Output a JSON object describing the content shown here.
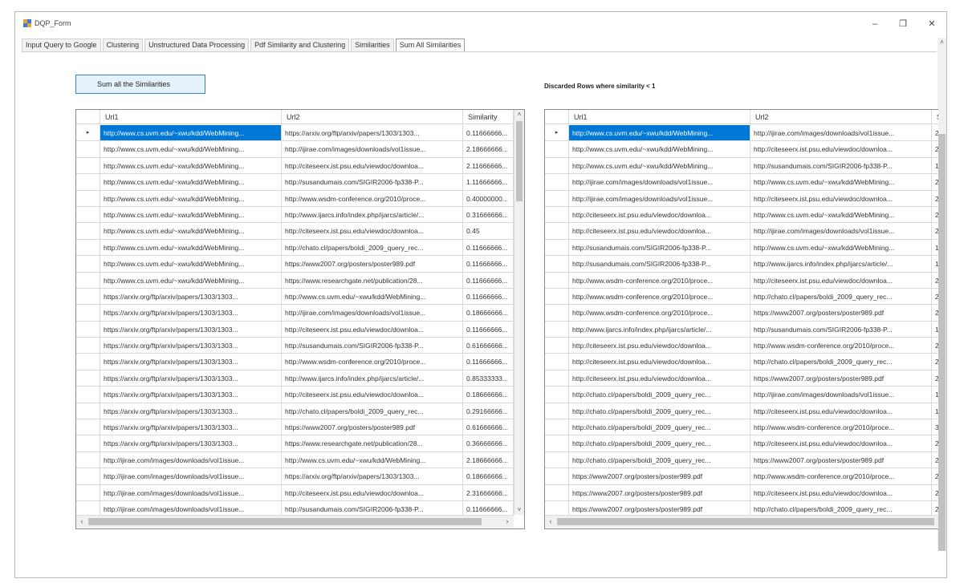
{
  "window": {
    "title": "DQP_Form",
    "controls": {
      "minimize": "–",
      "maximize": "❐",
      "close": "✕"
    }
  },
  "tabs": [
    {
      "label": "Input Query to Google",
      "active": false
    },
    {
      "label": "Clustering",
      "active": false
    },
    {
      "label": "Unstructured Data Processing",
      "active": false
    },
    {
      "label": "Pdf Similarity and Clustering",
      "active": false
    },
    {
      "label": "Similarities",
      "active": false
    },
    {
      "label": "Sum All Similarities",
      "active": true
    }
  ],
  "sum_button": {
    "label": "Sum all the Similarities"
  },
  "discarded_label": "Discarded Rows where similarity < 1",
  "left_grid": {
    "columns": [
      "Url1",
      "Url2",
      "Similarity"
    ],
    "rows": [
      [
        "http://www.cs.uvm.edu/~xwu/kdd/WebMining...",
        "https://arxiv.org/ftp/arxiv/papers/1303/1303...",
        "0.11666666..."
      ],
      [
        "http://www.cs.uvm.edu/~xwu/kdd/WebMining...",
        "http://ijirae.com/images/downloads/vol1issue...",
        "2.18666666..."
      ],
      [
        "http://www.cs.uvm.edu/~xwu/kdd/WebMining...",
        "http://citeseerx.ist.psu.edu/viewdoc/downloa...",
        "2.11666666..."
      ],
      [
        "http://www.cs.uvm.edu/~xwu/kdd/WebMining...",
        "http://susandumais.com/SIGIR2006-fp338-P...",
        "1.11666666..."
      ],
      [
        "http://www.cs.uvm.edu/~xwu/kdd/WebMining...",
        "http://www.wsdm-conference.org/2010/proce...",
        "0.40000000..."
      ],
      [
        "http://www.cs.uvm.edu/~xwu/kdd/WebMining...",
        "http://www.ijarcs.info/index.php/ijarcs/article/...",
        "0.31666666..."
      ],
      [
        "http://www.cs.uvm.edu/~xwu/kdd/WebMining...",
        "http://citeseerx.ist.psu.edu/viewdoc/downloa...",
        "0.45"
      ],
      [
        "http://www.cs.uvm.edu/~xwu/kdd/WebMining...",
        "http://chato.cl/papers/boldi_2009_query_rec...",
        "0.11666666..."
      ],
      [
        "http://www.cs.uvm.edu/~xwu/kdd/WebMining...",
        "https://www2007.org/posters/poster989.pdf",
        "0.11666666..."
      ],
      [
        "http://www.cs.uvm.edu/~xwu/kdd/WebMining...",
        "https://www.researchgate.net/publication/28...",
        "0.11666666..."
      ],
      [
        "https://arxiv.org/ftp/arxiv/papers/1303/1303...",
        "http://www.cs.uvm.edu/~xwu/kdd/WebMining...",
        "0.11666666..."
      ],
      [
        "https://arxiv.org/ftp/arxiv/papers/1303/1303...",
        "http://ijirae.com/images/downloads/vol1issue...",
        "0.18666666..."
      ],
      [
        "https://arxiv.org/ftp/arxiv/papers/1303/1303...",
        "http://citeseerx.ist.psu.edu/viewdoc/downloa...",
        "0.11666666..."
      ],
      [
        "https://arxiv.org/ftp/arxiv/papers/1303/1303...",
        "http://susandumais.com/SIGIR2006-fp338-P...",
        "0.61666666..."
      ],
      [
        "https://arxiv.org/ftp/arxiv/papers/1303/1303...",
        "http://www.wsdm-conference.org/2010/proce...",
        "0.11666666..."
      ],
      [
        "https://arxiv.org/ftp/arxiv/papers/1303/1303...",
        "http://www.ijarcs.info/index.php/ijarcs/article/...",
        "0.85333333..."
      ],
      [
        "https://arxiv.org/ftp/arxiv/papers/1303/1303...",
        "http://citeseerx.ist.psu.edu/viewdoc/downloa...",
        "0.18666666..."
      ],
      [
        "https://arxiv.org/ftp/arxiv/papers/1303/1303...",
        "http://chato.cl/papers/boldi_2009_query_rec...",
        "0.29166666..."
      ],
      [
        "https://arxiv.org/ftp/arxiv/papers/1303/1303...",
        "https://www2007.org/posters/poster989.pdf",
        "0.61666666..."
      ],
      [
        "https://arxiv.org/ftp/arxiv/papers/1303/1303...",
        "https://www.researchgate.net/publication/28...",
        "0.36666666..."
      ],
      [
        "http://ijirae.com/images/downloads/vol1issue...",
        "http://www.cs.uvm.edu/~xwu/kdd/WebMining...",
        "2.18666666..."
      ],
      [
        "http://ijirae.com/images/downloads/vol1issue...",
        "https://arxiv.org/ftp/arxiv/papers/1303/1303...",
        "0.18666666..."
      ],
      [
        "http://ijirae.com/images/downloads/vol1issue...",
        "http://citeseerx.ist.psu.edu/viewdoc/downloa...",
        "2.31666666..."
      ],
      [
        "http://ijirae.com/images/downloads/vol1issue...",
        "http://susandumais.com/SIGIR2006-fp338-P...",
        "0.11666666..."
      ]
    ]
  },
  "right_grid": {
    "columns": [
      "Url1",
      "Url2",
      "S"
    ],
    "rows": [
      [
        "http://www.cs.uvm.edu/~xwu/kdd/WebMining...",
        "http://ijirae.com/images/downloads/vol1issue...",
        "2"
      ],
      [
        "http://www.cs.uvm.edu/~xwu/kdd/WebMining...",
        "http://citeseerx.ist.psu.edu/viewdoc/downloa...",
        "2"
      ],
      [
        "http://www.cs.uvm.edu/~xwu/kdd/WebMining...",
        "http://susandumais.com/SIGIR2006-fp338-P...",
        "1"
      ],
      [
        "http://ijirae.com/images/downloads/vol1issue...",
        "http://www.cs.uvm.edu/~xwu/kdd/WebMining...",
        "2"
      ],
      [
        "http://ijirae.com/images/downloads/vol1issue...",
        "http://citeseerx.ist.psu.edu/viewdoc/downloa...",
        "2"
      ],
      [
        "http://citeseerx.ist.psu.edu/viewdoc/downloa...",
        "http://www.cs.uvm.edu/~xwu/kdd/WebMining...",
        "2"
      ],
      [
        "http://citeseerx.ist.psu.edu/viewdoc/downloa...",
        "http://ijirae.com/images/downloads/vol1issue...",
        "2"
      ],
      [
        "http://susandumais.com/SIGIR2006-fp338-P...",
        "http://www.cs.uvm.edu/~xwu/kdd/WebMining...",
        "1"
      ],
      [
        "http://susandumais.com/SIGIR2006-fp338-P...",
        "http://www.ijarcs.info/index.php/ijarcs/article/...",
        "1"
      ],
      [
        "http://www.wsdm-conference.org/2010/proce...",
        "http://citeseerx.ist.psu.edu/viewdoc/downloa...",
        "2"
      ],
      [
        "http://www.wsdm-conference.org/2010/proce...",
        "http://chato.cl/papers/boldi_2009_query_rec...",
        "2"
      ],
      [
        "http://www.wsdm-conference.org/2010/proce...",
        "https://www2007.org/posters/poster989.pdf",
        "2"
      ],
      [
        "http://www.ijarcs.info/index.php/ijarcs/article/...",
        "http://susandumais.com/SIGIR2006-fp338-P...",
        "1"
      ],
      [
        "http://citeseerx.ist.psu.edu/viewdoc/downloa...",
        "http://www.wsdm-conference.org/2010/proce...",
        "2"
      ],
      [
        "http://citeseerx.ist.psu.edu/viewdoc/downloa...",
        "http://chato.cl/papers/boldi_2009_query_rec...",
        "2"
      ],
      [
        "http://citeseerx.ist.psu.edu/viewdoc/downloa...",
        "https://www2007.org/posters/poster989.pdf",
        "2"
      ],
      [
        "http://chato.cl/papers/boldi_2009_query_rec...",
        "http://ijirae.com/images/downloads/vol1issue...",
        "1"
      ],
      [
        "http://chato.cl/papers/boldi_2009_query_rec...",
        "http://citeseerx.ist.psu.edu/viewdoc/downloa...",
        "1"
      ],
      [
        "http://chato.cl/papers/boldi_2009_query_rec...",
        "http://www.wsdm-conference.org/2010/proce...",
        "3"
      ],
      [
        "http://chato.cl/papers/boldi_2009_query_rec...",
        "http://citeseerx.ist.psu.edu/viewdoc/downloa...",
        "2"
      ],
      [
        "http://chato.cl/papers/boldi_2009_query_rec...",
        "https://www2007.org/posters/poster989.pdf",
        "2"
      ],
      [
        "https://www2007.org/posters/poster989.pdf",
        "http://www.wsdm-conference.org/2010/proce...",
        "2"
      ],
      [
        "https://www2007.org/posters/poster989.pdf",
        "http://citeseerx.ist.psu.edu/viewdoc/downloa...",
        "2"
      ],
      [
        "https://www2007.org/posters/poster989.pdf",
        "http://chato.cl/papers/boldi_2009_query_rec...",
        "2"
      ]
    ]
  },
  "colors": {
    "selection": "#0078d7",
    "button_bg": "#e5f1fb",
    "button_border": "#3c7fb1"
  },
  "icons": {
    "row_indicator": "▸",
    "scroll_left": "‹",
    "scroll_right": "›",
    "scroll_up": "˄",
    "scroll_down": "˅"
  }
}
